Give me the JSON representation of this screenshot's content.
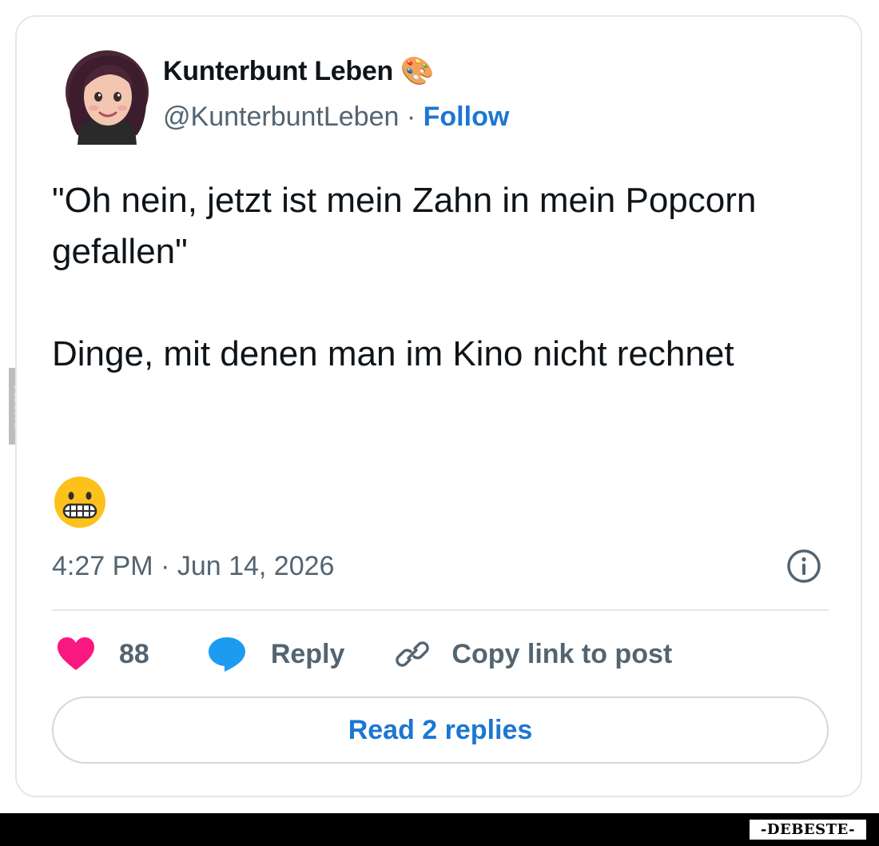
{
  "tweet": {
    "display_name": "Kunterbunt Leben 🎨",
    "handle": "@KunterbuntLeben",
    "separator": " · ",
    "follow_label": "Follow",
    "text_paragraphs": [
      "\"Oh nein, jetzt ist mein Zahn in mein Popcorn gefallen\"",
      "Dinge, mit denen man im Kino nicht rechnet"
    ],
    "emoji": "grimacing-face",
    "timestamp": "4:27 PM · Jun 14, 2026"
  },
  "actions": {
    "like_count": "88",
    "reply_label": "Reply",
    "copy_link_label": "Copy link to post"
  },
  "read_replies_label": "Read 2 replies",
  "watermark": {
    "side": "DEBESTE",
    "bottom": "-DEBESTE-"
  },
  "colors": {
    "text": "#0f1419",
    "secondary": "#536471",
    "link": "#1d76d2",
    "heart": "#f91880",
    "reply_bubble": "#1d9bf0",
    "border": "#e3e7ea"
  },
  "icons": {
    "like": "heart-icon",
    "reply": "speech-bubble-icon",
    "copy": "link-icon",
    "info": "info-icon"
  }
}
